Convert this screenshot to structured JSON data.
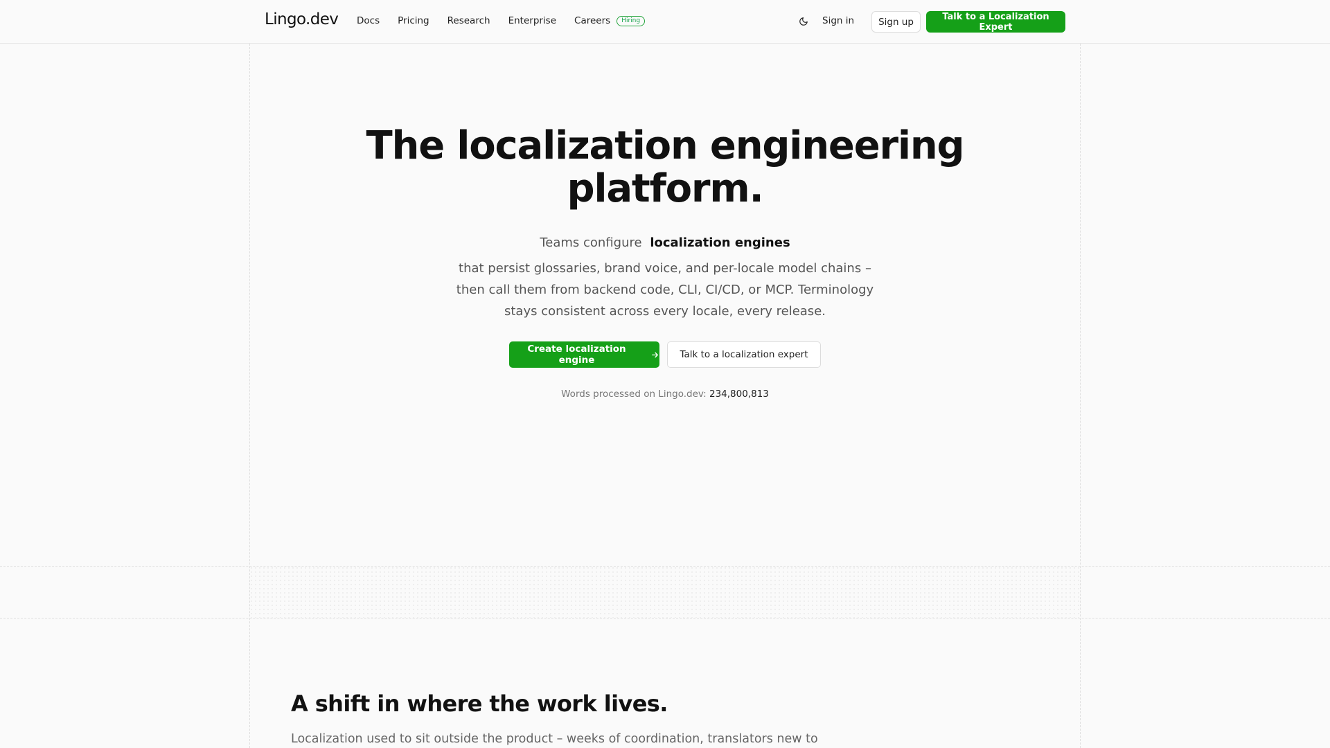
{
  "header": {
    "logo": "Lingo.dev",
    "nav": [
      {
        "label": "Docs"
      },
      {
        "label": "Pricing"
      },
      {
        "label": "Research"
      },
      {
        "label": "Enterprise"
      },
      {
        "label": "Careers",
        "badge": "Hiring"
      }
    ],
    "theme_icon": "moon-icon",
    "sign_in": "Sign in",
    "sign_up": "Sign up",
    "cta": "Talk to a Localization Expert"
  },
  "hero": {
    "title_line1": "The localization engineering",
    "title_line2": "platform.",
    "tagline_prefix": "Teams configure",
    "tagline_emphasis": "localization engines",
    "description": "that persist glossaries, brand voice, and per-locale model chains – then call them from backend code, CLI, CI/CD, or MCP. Terminology stays consistent across every locale, every release.",
    "primary_button": "Create localization engine",
    "primary_button_icon": "arrow-right-icon",
    "secondary_button": "Talk to a localization expert",
    "words_label": "Words processed on Lingo.dev:",
    "words_count": "234,800,813"
  },
  "section2": {
    "title": "A shift in where the work lives.",
    "text": "Localization used to sit outside the product – weeks of coordination, translators new to"
  },
  "colors": {
    "accent": "#15a018",
    "background": "#fafafa",
    "text": "#111111"
  }
}
